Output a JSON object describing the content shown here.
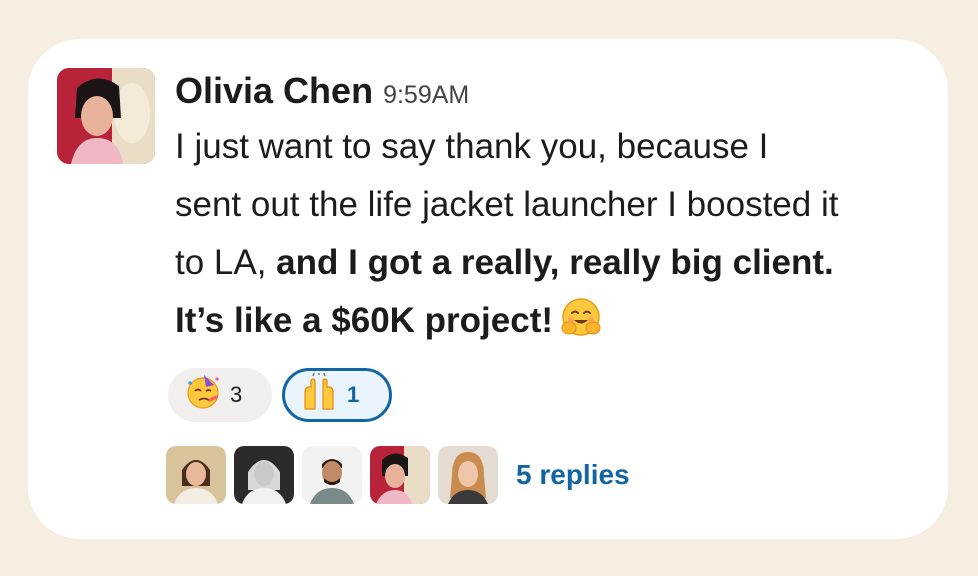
{
  "message": {
    "author": "Olivia Chen",
    "timestamp": "9:59AM",
    "line1": "I just want to say thank you, because I",
    "line2": "sent out the life jacket launcher I boosted it",
    "line3_plain": "to LA, ",
    "line3_bold": "and I got a really, really big client.",
    "line4_bold": "It’s like a $60K project!",
    "inline_emoji": "hugging-face-emoji"
  },
  "reactions": [
    {
      "emoji": "partying-face-emoji",
      "count": "3",
      "selected": false
    },
    {
      "emoji": "raising-hands-emoji",
      "count": "1",
      "selected": true
    }
  ],
  "thread": {
    "reply_avatars": [
      "avatar-1",
      "avatar-2",
      "avatar-3",
      "avatar-olivia",
      "avatar-5"
    ],
    "replies_label": "5 replies"
  },
  "colors": {
    "page_background": "#f7eee2",
    "card": "#ffffff",
    "link": "#1264a3",
    "selected_reaction_bg": "#eaf4fc"
  }
}
